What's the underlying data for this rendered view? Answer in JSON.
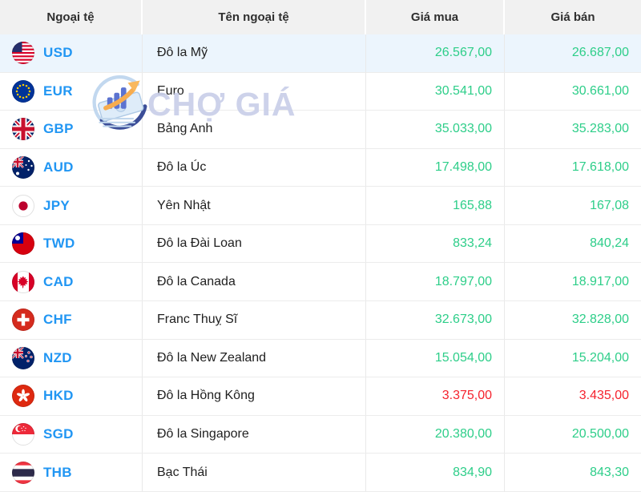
{
  "table": {
    "headers": [
      {
        "label": "Ngoại tệ"
      },
      {
        "label": "Tên ngoại tệ"
      },
      {
        "label": "Giá mua"
      },
      {
        "label": "Giá bán"
      }
    ],
    "rows": [
      {
        "code": "USD",
        "name": "Đô la Mỹ",
        "buy": "26.567,00",
        "sell": "26.687,00",
        "trend": "up",
        "flag": "us-flag-icon",
        "highlighted": true
      },
      {
        "code": "EUR",
        "name": "Euro",
        "buy": "30.541,00",
        "sell": "30.661,00",
        "trend": "up",
        "flag": "eu-flag-icon",
        "highlighted": false
      },
      {
        "code": "GBP",
        "name": "Bảng Anh",
        "buy": "35.033,00",
        "sell": "35.283,00",
        "trend": "up",
        "flag": "gb-flag-icon",
        "highlighted": false
      },
      {
        "code": "AUD",
        "name": "Đô la Úc",
        "buy": "17.498,00",
        "sell": "17.618,00",
        "trend": "up",
        "flag": "au-flag-icon",
        "highlighted": false
      },
      {
        "code": "JPY",
        "name": "Yên Nhật",
        "buy": "165,88",
        "sell": "167,08",
        "trend": "up",
        "flag": "jp-flag-icon",
        "highlighted": false
      },
      {
        "code": "TWD",
        "name": "Đô la Đài Loan",
        "buy": "833,24",
        "sell": "840,24",
        "trend": "up",
        "flag": "tw-flag-icon",
        "highlighted": false
      },
      {
        "code": "CAD",
        "name": "Đô la Canada",
        "buy": "18.797,00",
        "sell": "18.917,00",
        "trend": "up",
        "flag": "ca-flag-icon",
        "highlighted": false
      },
      {
        "code": "CHF",
        "name": "Franc Thuỵ Sĩ",
        "buy": "32.673,00",
        "sell": "32.828,00",
        "trend": "up",
        "flag": "ch-flag-icon",
        "highlighted": false
      },
      {
        "code": "NZD",
        "name": "Đô la New Zealand",
        "buy": "15.054,00",
        "sell": "15.204,00",
        "trend": "up",
        "flag": "nz-flag-icon",
        "highlighted": false
      },
      {
        "code": "HKD",
        "name": "Đô la Hồng Kông",
        "buy": "3.375,00",
        "sell": "3.435,00",
        "trend": "down",
        "flag": "hk-flag-icon",
        "highlighted": false
      },
      {
        "code": "SGD",
        "name": "Đô la Singapore",
        "buy": "20.380,00",
        "sell": "20.500,00",
        "trend": "up",
        "flag": "sg-flag-icon",
        "highlighted": false
      },
      {
        "code": "THB",
        "name": "Bạc Thái",
        "buy": "834,90",
        "sell": "843,30",
        "trend": "up",
        "flag": "th-flag-icon",
        "highlighted": false
      }
    ]
  },
  "watermark": {
    "text": "CHỢ GIÁ",
    "logo": "chogia-logo-icon"
  },
  "colors": {
    "up": "#2dce89",
    "down": "#f5222d",
    "code": "#2196f3",
    "header_bg": "#f1f1f1",
    "row_highlight": "#ecf5fd",
    "watermark_text": "#c9cfe9"
  }
}
